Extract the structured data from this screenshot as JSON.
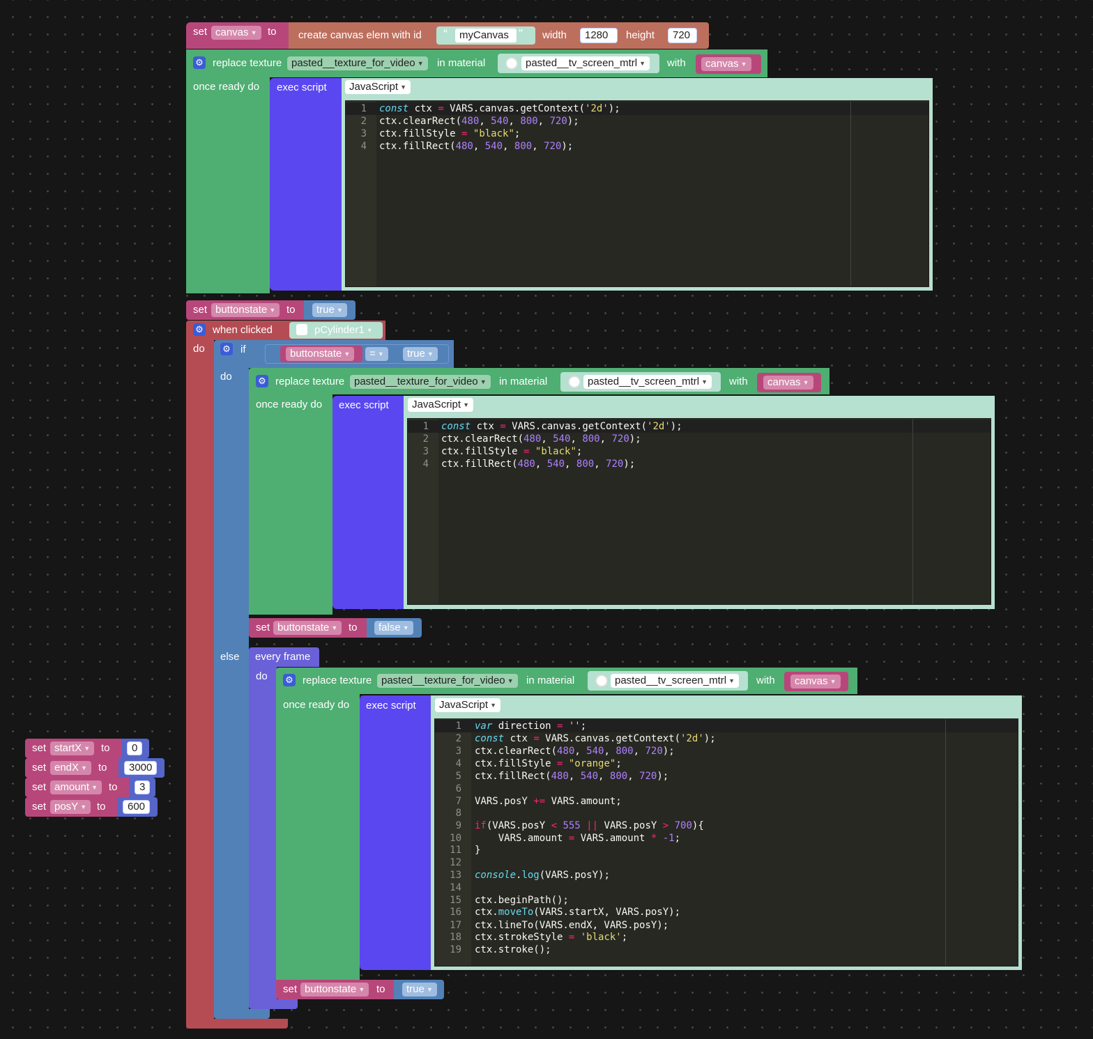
{
  "colors": {
    "bg": "#161616",
    "var_set": "#b7477a",
    "canvas_block": "#bd6f5e",
    "texture_green": "#4fae72",
    "script_blue": "#5b47f0",
    "script_area": "#b6e0d0",
    "when_red": "#b54c54",
    "if_blue": "#5281b8",
    "every_frame": "#6a61d8",
    "number_blue": "#5566c8",
    "editor_bg": "#272822"
  },
  "top": {
    "set": "set",
    "var": "canvas",
    "to": "to",
    "create": "create canvas elem with id",
    "id": "myCanvas",
    "width_label": "width",
    "width": "1280",
    "height_label": "height",
    "height": "720"
  },
  "rt1": {
    "replace": "replace texture",
    "texture": "pasted__texture_for_video",
    "in_material": "in material",
    "material": "pasted__tv_screen_mtrl",
    "with": "with",
    "canvas": "canvas",
    "once": "once ready do",
    "exec": "exec script",
    "lang": "JavaScript"
  },
  "code1": {
    "ln1": "1",
    "ln2": "2",
    "ln3": "3",
    "ln4": "4",
    "l1_kw": "const",
    "l1_a": " ctx ",
    "l1_op": "=",
    "l1_b": " VARS.canvas.getContext(",
    "l1_s": "'2d'",
    "l1_c": ");",
    "l2_a": "ctx.clearRect(",
    "l2_n1": "480",
    "l2_n2": "540",
    "l2_n3": "800",
    "l2_n4": "720",
    "l2_c": ");",
    "l3_a": "ctx.fillStyle ",
    "l3_op": "=",
    "l3_s": "\"black\"",
    "l3_c": ";",
    "l4_a": "ctx.fillRect(",
    "l4_n1": "480",
    "l4_n2": "540",
    "l4_n3": "800",
    "l4_n4": "720",
    "l4_c": ");"
  },
  "bs1": {
    "set": "set",
    "var": "buttonstate",
    "to": "to",
    "val": "true"
  },
  "click": {
    "when": "when clicked",
    "obj": "pCylinder1",
    "do": "do"
  },
  "ifb": {
    "if": "if",
    "var": "buttonstate",
    "op": "=",
    "val": "true",
    "do": "do",
    "else": "else"
  },
  "rt2": {
    "replace": "replace texture",
    "texture": "pasted__texture_for_video",
    "in_material": "in material",
    "material": "pasted__tv_screen_mtrl",
    "with": "with",
    "canvas": "canvas",
    "once": "once ready do",
    "exec": "exec script",
    "lang": "JavaScript"
  },
  "bs2": {
    "set": "set",
    "var": "buttonstate",
    "to": "to",
    "val": "false"
  },
  "every": {
    "label": "every frame",
    "do": "do"
  },
  "rt3": {
    "replace": "replace texture",
    "texture": "pasted__texture_for_video",
    "in_material": "in material",
    "material": "pasted__tv_screen_mtrl",
    "with": "with",
    "canvas": "canvas",
    "once": "once ready do",
    "exec": "exec script",
    "lang": "JavaScript"
  },
  "code3": {
    "lines": [
      "1",
      "2",
      "3",
      "4",
      "5",
      "6",
      "7",
      "8",
      "9",
      "10",
      "11",
      "12",
      "13",
      "14",
      "15",
      "16",
      "17",
      "18",
      "19"
    ],
    "l1_kw": "var",
    "l1_a": " direction ",
    "l1_op": "=",
    "l1_s": " ''",
    "l1_c": ";",
    "l2_kw": "const",
    "l2_a": " ctx ",
    "l2_op": "=",
    "l2_b": " VARS.canvas.getContext(",
    "l2_s": "'2d'",
    "l2_c": ");",
    "l3_a": "ctx.clearRect(",
    "l3_n1": "480",
    "l3_n2": "540",
    "l3_n3": "800",
    "l3_n4": "720",
    "l3_c": ");",
    "l4_a": "ctx.fillStyle ",
    "l4_op": "=",
    "l4_s": " \"orange\"",
    "l4_c": ";",
    "l5_a": "ctx.fillRect(",
    "l5_n1": "480",
    "l5_n2": "540",
    "l5_n3": "800",
    "l5_n4": "720",
    "l5_c": ");",
    "l7_a": "VARS.posY ",
    "l7_op": "+=",
    "l7_b": " VARS.amount;",
    "l9_if": "if",
    "l9_a": "(VARS.posY ",
    "l9_op1": "<",
    "l9_n1": " 555 ",
    "l9_op2": "||",
    "l9_b": " VARS.posY ",
    "l9_op3": ">",
    "l9_n2": " 700",
    "l9_c": "){",
    "l10_a": "    VARS.amount ",
    "l10_op": "=",
    "l10_b": " VARS.amount ",
    "l10_op2": "*",
    "l10_n": " -1",
    "l10_c": ";",
    "l11": "}",
    "l13_fn": "console",
    "l13_a": ".",
    "l13_fn2": "log",
    "l13_b": "(VARS.posY);",
    "l15": "ctx.beginPath();",
    "l16_a": "ctx.",
    "l16_fn": "moveTo",
    "l16_b": "(VARS.startX, VARS.posY);",
    "l17": "ctx.lineTo(VARS.endX, VARS.posY);",
    "l18_a": "ctx.strokeStyle ",
    "l18_op": "=",
    "l18_s": " 'black'",
    "l18_c": ";",
    "l19": "ctx.stroke();"
  },
  "bs3": {
    "set": "set",
    "var": "buttonstate",
    "to": "to",
    "val": "true"
  },
  "vars": [
    {
      "set": "set",
      "name": "startX",
      "to": "to",
      "val": "0"
    },
    {
      "set": "set",
      "name": "endX",
      "to": "to",
      "val": "3000"
    },
    {
      "set": "set",
      "name": "amount",
      "to": "to",
      "val": "3"
    },
    {
      "set": "set",
      "name": "posY",
      "to": "to",
      "val": "600"
    }
  ]
}
